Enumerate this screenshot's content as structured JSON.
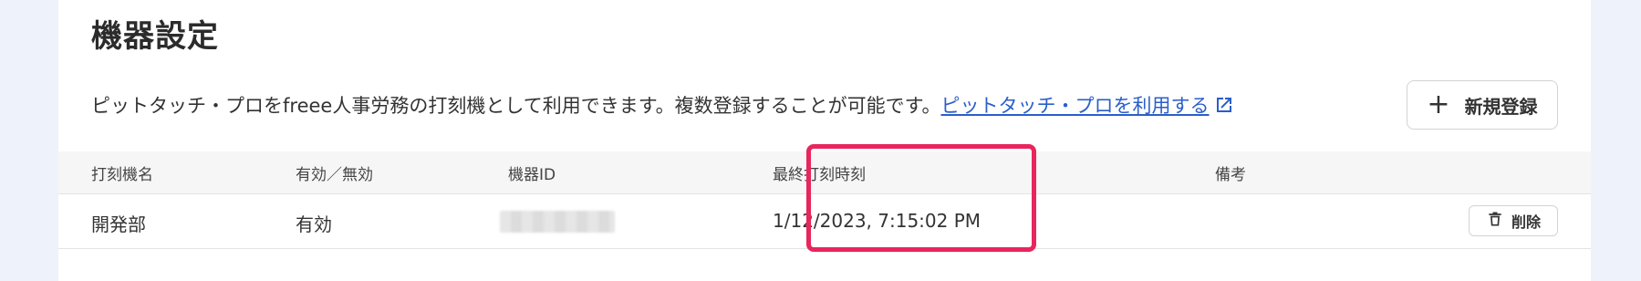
{
  "page": {
    "title": "機器設定",
    "description": "ピットタッチ・プロをfreee人事労務の打刻機として利用できます。複数登録することが可能です。",
    "link_label": "ピットタッチ・プロを利用する",
    "new_button_label": "新規登録"
  },
  "table": {
    "columns": [
      "打刻機名",
      "有効／無効",
      "機器ID",
      "最終打刻時刻",
      "備考"
    ],
    "rows": [
      {
        "name": "開発部",
        "status": "有効",
        "last_punch": "1/12/2023, 7:15:02 PM",
        "note": "",
        "delete_label": "削除"
      }
    ]
  },
  "colors": {
    "accent_link": "#2a5ec9",
    "highlight_border": "#e8255d",
    "page_background": "#eef2fb"
  },
  "icons": [
    "external-link-icon",
    "plus-icon",
    "trash-icon"
  ]
}
